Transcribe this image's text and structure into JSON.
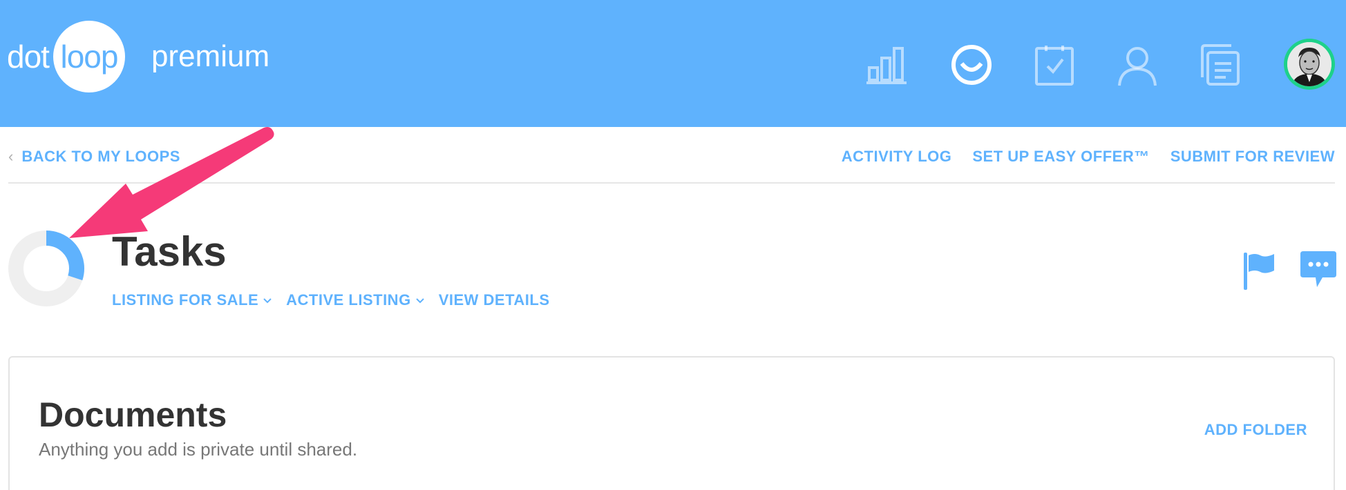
{
  "header": {
    "logo_dot": "dot",
    "logo_loop": "loop",
    "plan": "premium",
    "nav_icons": [
      "bar-chart-icon",
      "smile-icon",
      "checklist-icon",
      "user-icon",
      "documents-icon"
    ],
    "avatar": "user-avatar"
  },
  "subnav": {
    "back_label": "BACK TO MY LOOPS",
    "activity_log": "ACTIVITY LOG",
    "easy_offer": "SET UP EASY OFFER™",
    "submit_review": "SUBMIT FOR REVIEW"
  },
  "loop": {
    "title": "Tasks",
    "type": "LISTING FOR SALE",
    "status": "ACTIVE LISTING",
    "view_details": "VIEW DETAILS",
    "progress_fraction": 0.3
  },
  "documents": {
    "title": "Documents",
    "subtitle": "Anything you add is private until shared.",
    "add_folder": "ADD FOLDER"
  },
  "colors": {
    "topbar": "#5fb2fd",
    "accent": "#5fb2fd",
    "avatar_ring": "#1ed18a",
    "annotation_arrow": "#f53a78"
  }
}
